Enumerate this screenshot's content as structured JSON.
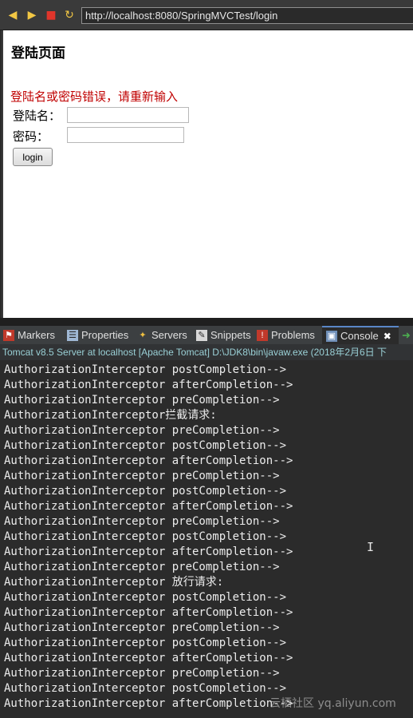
{
  "browser": {
    "url": "http://localhost:8080/SpringMVCTest/login",
    "icons": [
      "back-arrow-icon",
      "forward-arrow-icon",
      "stop-icon",
      "refresh-icon"
    ]
  },
  "page": {
    "title": "登陆页面",
    "error": "登陆名或密码错误，请重新输入",
    "username_label": "登陆名：",
    "password_label": "密码：",
    "login_button": "login"
  },
  "tabs": [
    {
      "label": "Markers",
      "icon": "markers-icon"
    },
    {
      "label": "Properties",
      "icon": "properties-icon"
    },
    {
      "label": "Servers",
      "icon": "servers-icon"
    },
    {
      "label": "Snippets",
      "icon": "snippets-icon"
    },
    {
      "label": "Problems",
      "icon": "problems-icon"
    },
    {
      "label": "Console",
      "icon": "console-icon",
      "active": true
    }
  ],
  "server_status": "Tomcat v8.5 Server at localhost [Apache Tomcat] D:\\JDK8\\bin\\javaw.exe (2018年2月6日 下",
  "console_lines": [
    "AuthorizationInterceptor postCompletion-->",
    "AuthorizationInterceptor afterCompletion-->",
    "AuthorizationInterceptor preCompletion-->",
    "AuthorizationInterceptor拦截请求:",
    "AuthorizationInterceptor preCompletion-->",
    "AuthorizationInterceptor postCompletion-->",
    "AuthorizationInterceptor afterCompletion-->",
    "AuthorizationInterceptor preCompletion-->",
    "AuthorizationInterceptor postCompletion-->",
    "AuthorizationInterceptor afterCompletion-->",
    "AuthorizationInterceptor preCompletion-->",
    "AuthorizationInterceptor postCompletion-->",
    "AuthorizationInterceptor afterCompletion-->",
    "AuthorizationInterceptor preCompletion-->",
    "AuthorizationInterceptor 放行请求:",
    "AuthorizationInterceptor postCompletion-->",
    "AuthorizationInterceptor afterCompletion-->",
    "AuthorizationInterceptor preCompletion-->",
    "AuthorizationInterceptor postCompletion-->",
    "AuthorizationInterceptor afterCompletion-->",
    "AuthorizationInterceptor preCompletion-->",
    "AuthorizationInterceptor postCompletion-->",
    "AuthorizationInterceptor afterCompletion-->"
  ],
  "watermark": "云栖社区 yq.aliyun.com",
  "colors": {
    "error": "#c00000",
    "console_bg": "#2b2b2b",
    "console_text": "#ececec",
    "server_bar_text": "#9ad0d6"
  }
}
